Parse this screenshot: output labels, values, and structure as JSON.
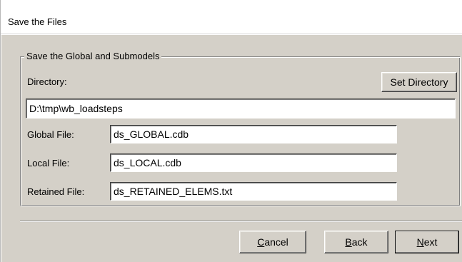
{
  "window": {
    "title": "Save the Files"
  },
  "group": {
    "legend": "Save the Global and Submodels"
  },
  "directory": {
    "label": "Directory:",
    "set_button_label": "Set Directory",
    "value": "D:\\tmp\\wb_loadsteps"
  },
  "files": {
    "global_label": "Global File:",
    "global_value": "ds_GLOBAL.cdb",
    "local_label": "Local File:",
    "local_value": "ds_LOCAL.cdb",
    "retained_label": "Retained File:",
    "retained_value": "ds_RETAINED_ELEMS.txt"
  },
  "buttons": {
    "cancel_hotkey": "C",
    "cancel_rest": "ancel",
    "back_hotkey": "B",
    "back_rest": "ack",
    "next_hotkey": "N",
    "next_rest": "ext"
  }
}
